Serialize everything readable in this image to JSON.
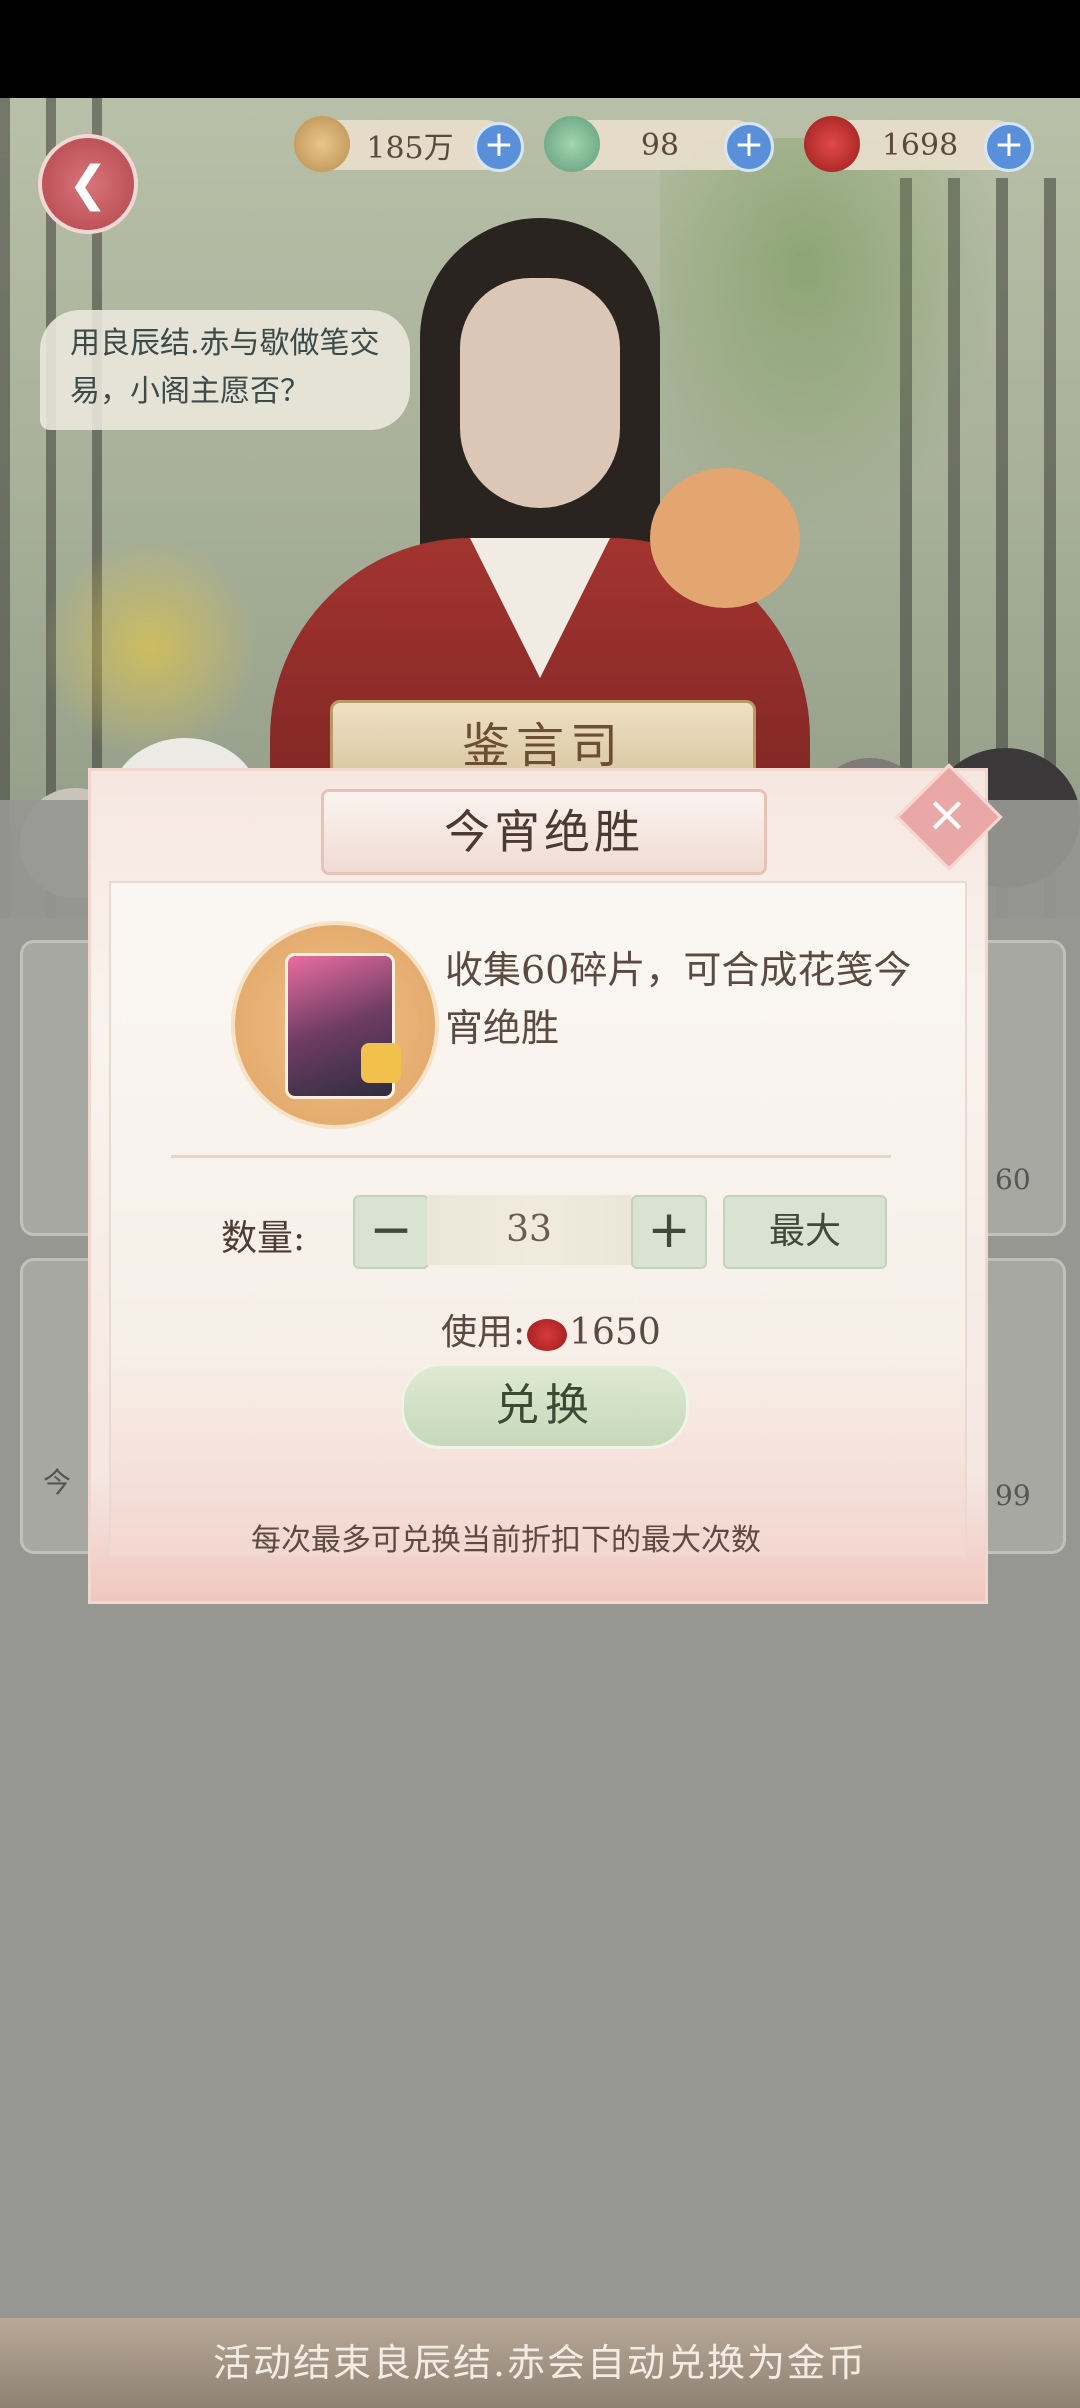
{
  "resources": {
    "coins": "185万",
    "jade": "98",
    "seal": "1698"
  },
  "speech_text": "用良辰结.赤与歇做笔交易，小阁主愿否？",
  "nameplate": "鉴言司",
  "modal": {
    "title": "今宵绝胜",
    "description": "收集60碎片，可合成花笺今宵绝胜",
    "quantity_label": "数量:",
    "minus_label": "−",
    "quantity_value": "33",
    "plus_label": "+",
    "max_label": "最大",
    "cost_prefix": "使用:",
    "cost_value": "1650",
    "exchange_label": "兑换",
    "note": "每次最多可兑换当前折扣下的最大次数",
    "close_label": "×"
  },
  "background_cards": {
    "right_top_value": "60",
    "right_bottom_value": "99",
    "left_bottom_label": "今"
  },
  "bottom_banner": "活动结束良辰结.赤会自动兑换为金币",
  "icons": {
    "back": "back-arrow-icon",
    "coin": "paw-coin-icon",
    "jade": "jade-icon",
    "seal": "red-seal-icon",
    "close": "close-icon"
  },
  "colors": {
    "accent_green": "#d8e3d1",
    "resource_plus": "#5a8fd9",
    "back_button": "#b2454c"
  }
}
